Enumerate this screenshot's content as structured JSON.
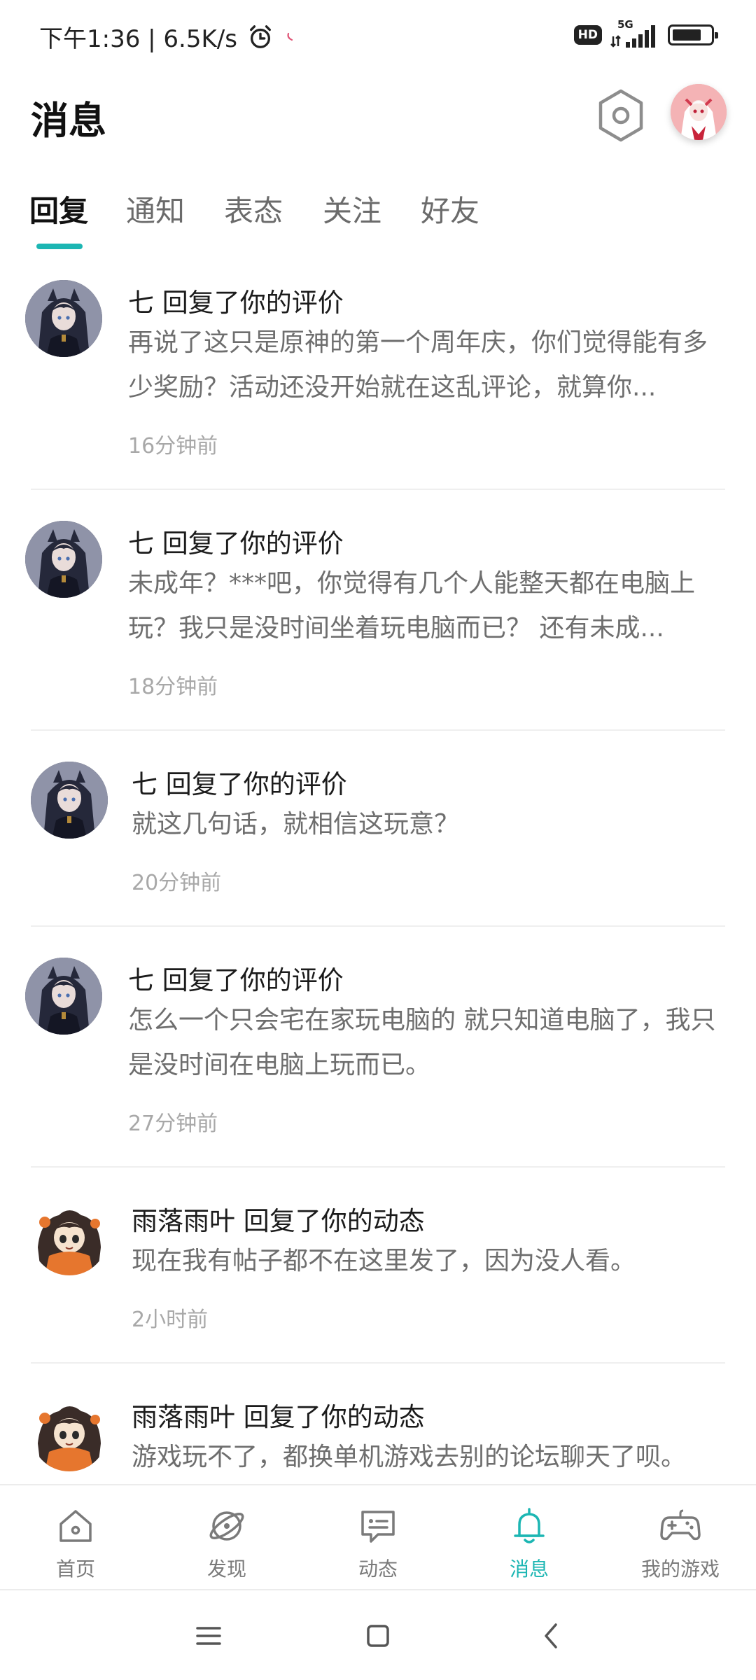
{
  "status_bar": {
    "time_speed": "下午1:36 | 6.5K/s",
    "hd": "HD",
    "network": "5G"
  },
  "header": {
    "title": "消息"
  },
  "tabs": [
    {
      "label": "回复",
      "active": true
    },
    {
      "label": "通知",
      "active": false
    },
    {
      "label": "表态",
      "active": false
    },
    {
      "label": "关注",
      "active": false
    },
    {
      "label": "好友",
      "active": false
    }
  ],
  "messages": [
    {
      "title": "七 回复了你的评价",
      "body": "再说了这只是原神的第一个周年庆，你们觉得能有多少奖励？活动还没开始就在这乱评论，就算你...",
      "time": "16分钟前",
      "avatar": "dark-hair-character"
    },
    {
      "title": "七 回复了你的评价",
      "body": "未成年？***吧，你觉得有几个人能整天都在电脑上玩？我只是没时间坐着玩电脑而已？ 还有未成...",
      "time": "18分钟前",
      "avatar": "dark-hair-character"
    },
    {
      "title": "七 回复了你的评价",
      "body": "就这几句话，就相信这玩意？",
      "time": "20分钟前",
      "avatar": "dark-hair-character"
    },
    {
      "title": "七 回复了你的评价",
      "body": "怎么一个只会宅在家玩电脑的 就只知道电脑了，我只是没时间在电脑上玩而已。",
      "time": "27分钟前",
      "avatar": "dark-hair-character"
    },
    {
      "title": "雨落雨叶 回复了你的动态",
      "body": "现在我有帖子都不在这里发了，因为没人看。",
      "time": "2小时前",
      "avatar": "orange-character"
    },
    {
      "title": "雨落雨叶 回复了你的动态",
      "body": "游戏玩不了，都换单机游戏去别的论坛聊天了呗。",
      "time": "",
      "avatar": "orange-character"
    }
  ],
  "bottom_nav": [
    {
      "label": "首页",
      "icon": "home-icon",
      "active": false
    },
    {
      "label": "发现",
      "icon": "discover-icon",
      "active": false
    },
    {
      "label": "动态",
      "icon": "feed-icon",
      "active": false
    },
    {
      "label": "消息",
      "icon": "bell-icon",
      "active": true
    },
    {
      "label": "我的游戏",
      "icon": "gamepad-icon",
      "active": false
    }
  ],
  "colors": {
    "accent": "#1cb6b3",
    "text_primary": "#1b1b1b",
    "text_secondary": "#6e6e6e",
    "text_muted": "#a8a8a8"
  }
}
